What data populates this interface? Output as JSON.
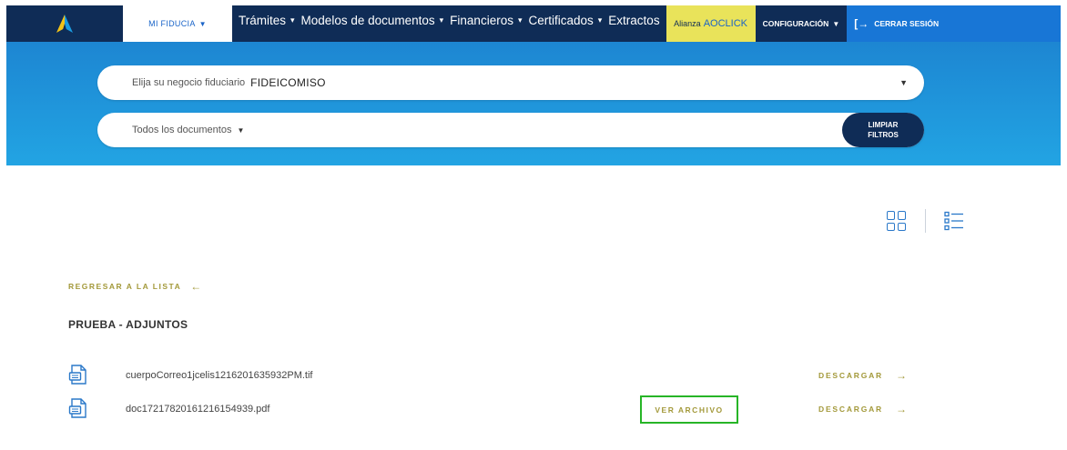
{
  "colors": {
    "nav_bg": "#0f2c56",
    "band": "#1d86d2",
    "accent_gold": "#a3993a",
    "alianza_bg": "#e9e35a",
    "logout_bg": "#1876d6",
    "highlight": "#27b527"
  },
  "nav": {
    "mi_fiducia": "MI FIDUCIA",
    "links": [
      "Trámites",
      "Modelos de documentos",
      "Financieros",
      "Certificados",
      "Extractos"
    ],
    "alianza_prefix": "Alianza",
    "alianza_click": "AOCLICK",
    "config": "CONFIGURACIÓN",
    "logout": "CERRAR SESIÓN"
  },
  "filters": {
    "negocio_label": "Elija su negocio fiduciario",
    "negocio_value": "FIDEICOMISO",
    "documentos": "Todos los documentos",
    "limpiar_line1": "LIMPIAR",
    "limpiar_line2": "FILTROS"
  },
  "content": {
    "back_label": "REGRESAR A LA LISTA",
    "title": "PRUEBA - ADJUNTOS",
    "files": [
      {
        "name": "cuerpoCorreo1jcelis1216201635932PM.tif",
        "download": "DESCARGAR"
      },
      {
        "name": "doc17217820161216154939.pdf",
        "view": "VER ARCHIVO",
        "download": "DESCARGAR"
      }
    ]
  }
}
